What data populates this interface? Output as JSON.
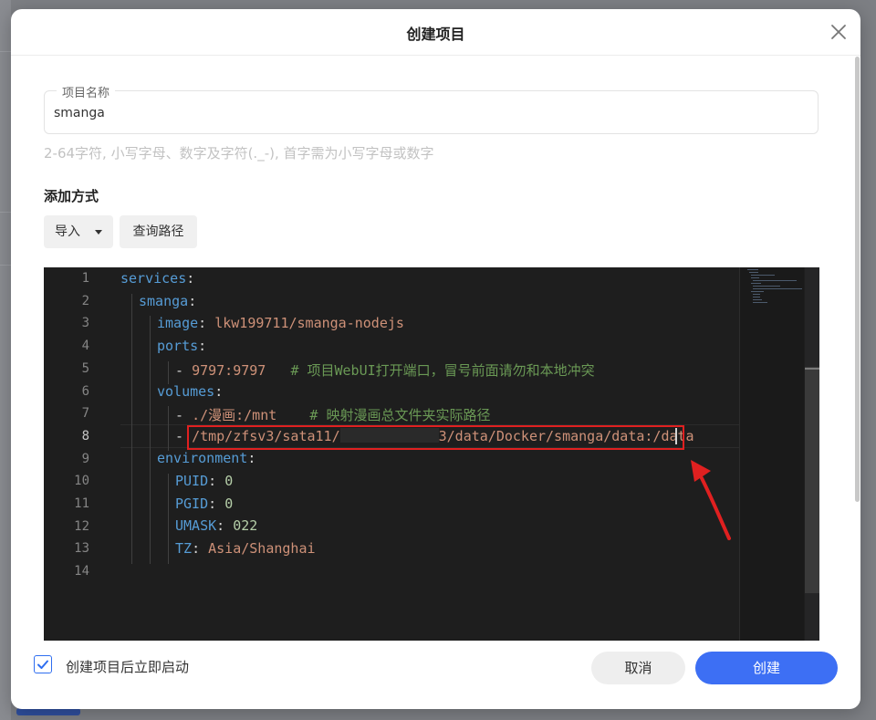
{
  "dialog": {
    "title": "创建项目",
    "project_name_label": "项目名称",
    "project_name_value": "smanga",
    "hint": "2-64字符, 小写字母、数字及字符(._-), 首字需为小写字母或数字",
    "method_label": "添加方式",
    "import_label": "导入",
    "query_path_label": "查询路径",
    "autostart_label": "创建项目后立即启动",
    "autostart_checked": true,
    "cancel_label": "取消",
    "create_label": "创建"
  },
  "editor": {
    "line_numbers": [
      "1",
      "2",
      "3",
      "4",
      "5",
      "6",
      "7",
      "8",
      "9",
      "10",
      "11",
      "12",
      "13",
      "14"
    ],
    "active_line": "8",
    "l1": {
      "key": "services",
      "colon": ":"
    },
    "l2": {
      "key": "smanga",
      "colon": ":"
    },
    "l3": {
      "key": "image",
      "colon": ": ",
      "value": "lkw199711/smanga-nodejs"
    },
    "l4": {
      "key": "ports",
      "colon": ":"
    },
    "l5": {
      "dash": "- ",
      "value": "9797:9797",
      "gap": "   ",
      "comment": "# 项目WebUI打开端口，冒号前面请勿和本地冲突"
    },
    "l6": {
      "key": "volumes",
      "colon": ":"
    },
    "l7": {
      "dash": "- ",
      "value": "./漫画:/mnt",
      "gap": "    ",
      "comment": "# 映射漫画总文件夹实际路径"
    },
    "l8": {
      "dash": "- ",
      "value_a": "/tmp/zfsv3/sata11/",
      "value_b": "3/data/Docker/smanga/data",
      "value_c": ":/data"
    },
    "l9": {
      "key": "environment",
      "colon": ":"
    },
    "l10": {
      "key": "PUID",
      "colon": ": ",
      "value": "0"
    },
    "l11": {
      "key": "PGID",
      "colon": ": ",
      "value": "0"
    },
    "l12": {
      "key": "UMASK",
      "colon": ": ",
      "value": "022"
    },
    "l13": {
      "key": "TZ",
      "colon": ": ",
      "value": "Asia/Shanghai"
    }
  },
  "colors": {
    "accent": "#3d6ff4",
    "annotation_red": "#e02020",
    "editor_bg": "#1e1e1e"
  },
  "icons": [
    "close-icon",
    "caret-down-icon",
    "check-icon",
    "red-arrow-annotation"
  ]
}
